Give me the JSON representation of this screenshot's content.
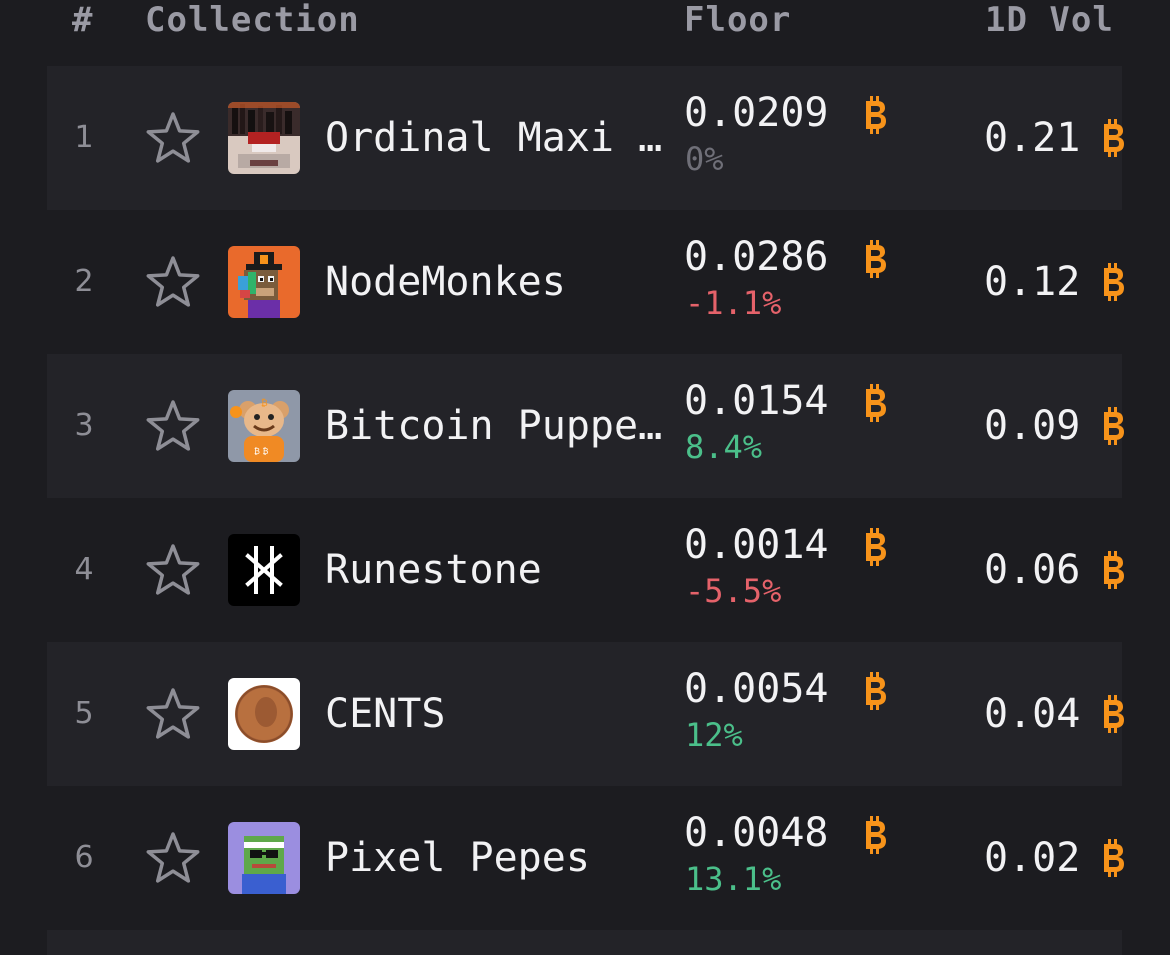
{
  "header": {
    "rank": "#",
    "collection": "Collection",
    "floor": "Floor",
    "volume": "1D Vol"
  },
  "currency_icon": "bitcoin-icon",
  "colors": {
    "background": "#1c1c20",
    "row_alt": "#232328",
    "bitcoin": "#f7931a",
    "positive": "#4bbf8a",
    "negative": "#e5626a",
    "neutral": "#6f6f78",
    "text": "#f2f2f4",
    "muted": "#9a9aa4"
  },
  "rows": [
    {
      "rank": "1",
      "name": "Ordinal Maxi Biz",
      "floor": "0.0209",
      "change": "0%",
      "change_dir": "neutral",
      "volume": "0.21",
      "avatar": "ordinal-maxi-biz-avatar"
    },
    {
      "rank": "2",
      "name": "NodeMonkes",
      "floor": "0.0286",
      "change": "-1.1%",
      "change_dir": "negative",
      "volume": "0.12",
      "avatar": "nodemonkes-avatar"
    },
    {
      "rank": "3",
      "name": "Bitcoin Puppets",
      "floor": "0.0154",
      "change": "8.4%",
      "change_dir": "positive",
      "volume": "0.09",
      "avatar": "bitcoin-puppets-avatar"
    },
    {
      "rank": "4",
      "name": "Runestone",
      "floor": "0.0014",
      "change": "-5.5%",
      "change_dir": "negative",
      "volume": "0.06",
      "avatar": "runestone-avatar"
    },
    {
      "rank": "5",
      "name": "CENTS",
      "floor": "0.0054",
      "change": "12%",
      "change_dir": "positive",
      "volume": "0.04",
      "avatar": "cents-avatar"
    },
    {
      "rank": "6",
      "name": "Pixel Pepes",
      "floor": "0.0048",
      "change": "13.1%",
      "change_dir": "positive",
      "volume": "0.02",
      "avatar": "pixel-pepes-avatar"
    }
  ]
}
